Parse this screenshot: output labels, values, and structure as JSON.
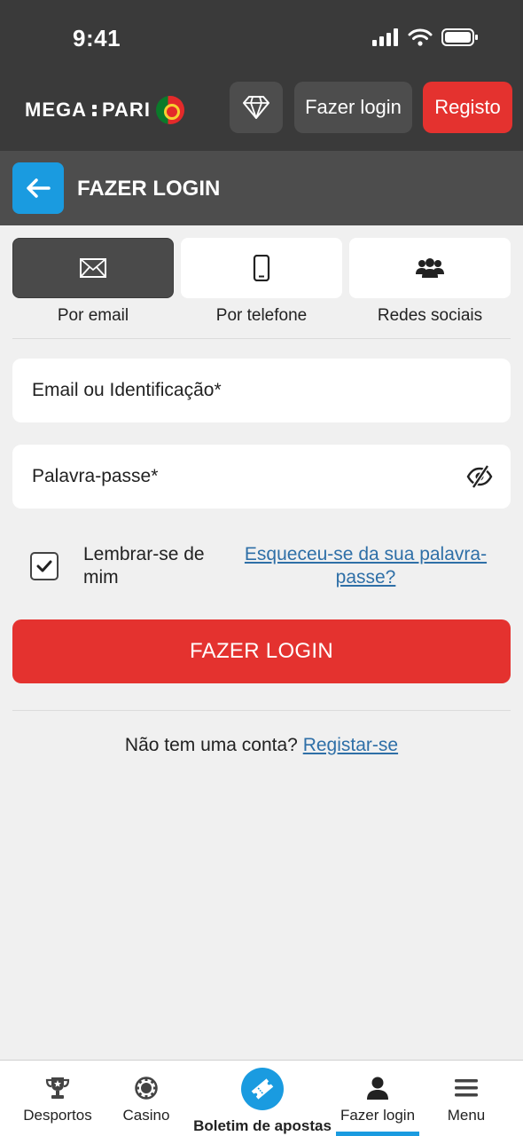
{
  "status_bar": {
    "time": "9:41"
  },
  "header": {
    "logo": {
      "left": "MEGA",
      "right": "PARI"
    },
    "diamond_icon": "diamond-icon",
    "login_label": "Fazer login",
    "register_label": "Registo"
  },
  "title_bar": {
    "title": "FAZER LOGIN",
    "back_icon": "arrow-left-icon"
  },
  "tabs": [
    {
      "label": "Por email",
      "icon": "envelope-icon",
      "active": true
    },
    {
      "label": "Por telefone",
      "icon": "phone-icon",
      "active": false
    },
    {
      "label": "Redes sociais",
      "icon": "users-icon",
      "active": false
    }
  ],
  "form": {
    "email_placeholder": "Email ou Identificação*",
    "password_placeholder": "Palavra-passe*",
    "remember_label": "Lembrar-se de mim",
    "remember_checked": true,
    "forgot_label": "Esqueceu-se da sua palavra-passe?",
    "submit_label": "FAZER LOGIN"
  },
  "signup": {
    "prompt": "Não tem uma conta?",
    "link": "Registar-se"
  },
  "bottom_nav": {
    "items": [
      {
        "label": "Desportos",
        "icon": "trophy-icon"
      },
      {
        "label": "Casino",
        "icon": "casino-chip-icon"
      },
      {
        "label": "Boletim de apostas",
        "icon": "ticket-icon"
      },
      {
        "label": "Fazer login",
        "icon": "user-icon",
        "active": true
      },
      {
        "label": "Menu",
        "icon": "hamburger-icon"
      }
    ]
  },
  "colors": {
    "accent_red": "#e4322f",
    "accent_blue": "#1a9be0",
    "header_bg": "#3a3a3a",
    "link_blue": "#2e6fa7"
  }
}
